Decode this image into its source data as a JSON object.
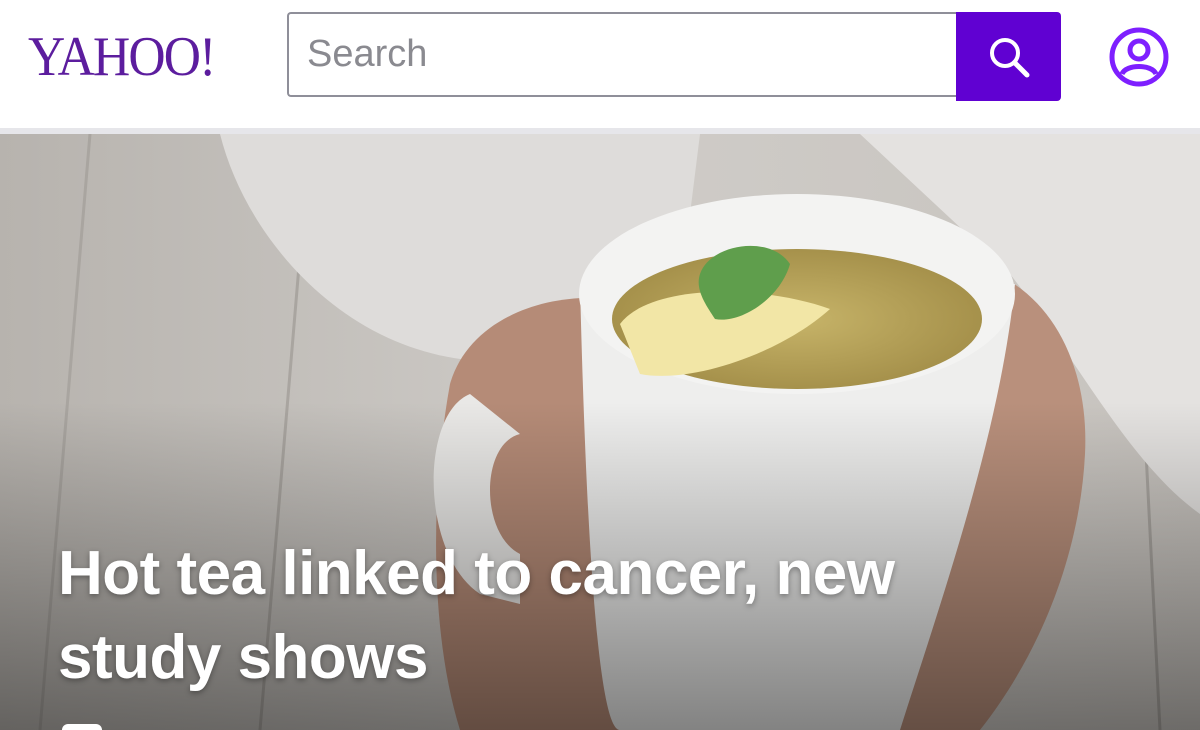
{
  "header": {
    "logo_text": "YAHOO!",
    "search": {
      "placeholder": "Search",
      "value": ""
    },
    "search_button_icon": "search-icon",
    "profile_icon": "user-circle-icon"
  },
  "hero": {
    "image_subject": "hands holding white mug of tea with lemon slice and mint leaf",
    "headline": "Hot tea linked to cancer, new study shows"
  },
  "colors": {
    "brand_purple": "#5c1d9e",
    "search_button": "#6001d2",
    "profile_icon": "#7e1fff"
  }
}
